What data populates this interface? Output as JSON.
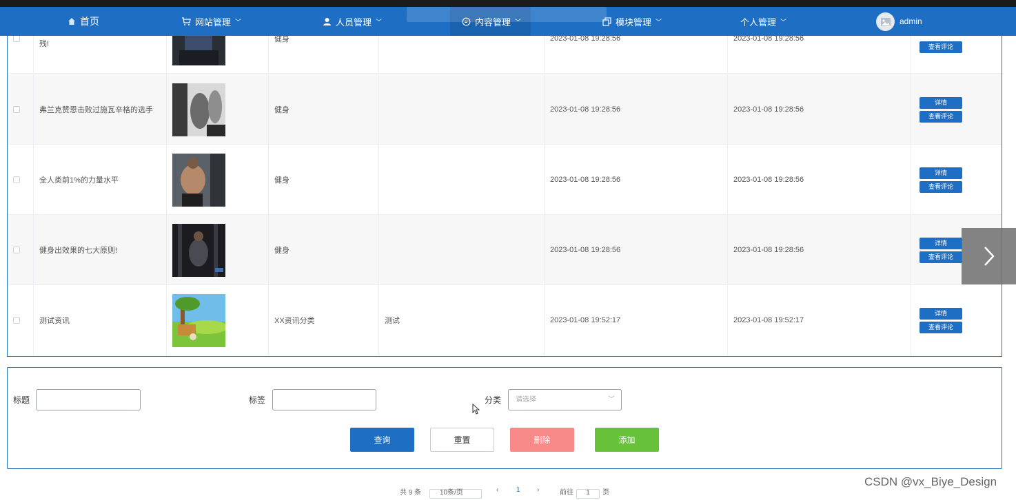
{
  "nav": {
    "home": "首页",
    "site": "网站管理",
    "people": "人员管理",
    "content": "内容管理",
    "module": "模块管理",
    "personal": "个人管理",
    "user": "admin",
    "chevron": "﹀"
  },
  "table": {
    "rows": [
      {
        "title": "残!",
        "category": "健身",
        "tags": "",
        "created": "2023-01-08 19:28:56",
        "updated": "2023-01-08 19:28:56",
        "detail": "",
        "comments": "查看评论"
      },
      {
        "title": "弗兰克赞恩击败过施瓦辛格的选手",
        "category": "健身",
        "tags": "",
        "created": "2023-01-08 19:28:56",
        "updated": "2023-01-08 19:28:56",
        "detail": "详情",
        "comments": "查看评论"
      },
      {
        "title": "全人类前1%的力量水平",
        "category": "健身",
        "tags": "",
        "created": "2023-01-08 19:28:56",
        "updated": "2023-01-08 19:28:56",
        "detail": "详情",
        "comments": "查看评论"
      },
      {
        "title": "健身出效果的七大原则!",
        "category": "健身",
        "tags": "",
        "created": "2023-01-08 19:28:56",
        "updated": "2023-01-08 19:28:56",
        "detail": "详情",
        "comments": "查看评论"
      },
      {
        "title": "测试资讯",
        "category": "XX资讯分类",
        "tags": "测试",
        "created": "2023-01-08 19:52:17",
        "updated": "2023-01-08 19:52:17",
        "detail": "详情",
        "comments": "查看评论"
      }
    ]
  },
  "search": {
    "title_label": "标题",
    "tag_label": "标签",
    "category_label": "分类",
    "category_placeholder": "请选择",
    "query": "查询",
    "reset": "重置",
    "delete": "删除",
    "add": "添加"
  },
  "pager": {
    "total": "共 9 条",
    "page_size": "10条/页",
    "current": "1",
    "goto": "前往",
    "goto_value": "1",
    "page_unit": "页"
  },
  "watermark": "CSDN @vx_Biye_Design",
  "colors": {
    "primary": "#1e6fc4",
    "danger": "#f78989",
    "success": "#67c23a"
  }
}
